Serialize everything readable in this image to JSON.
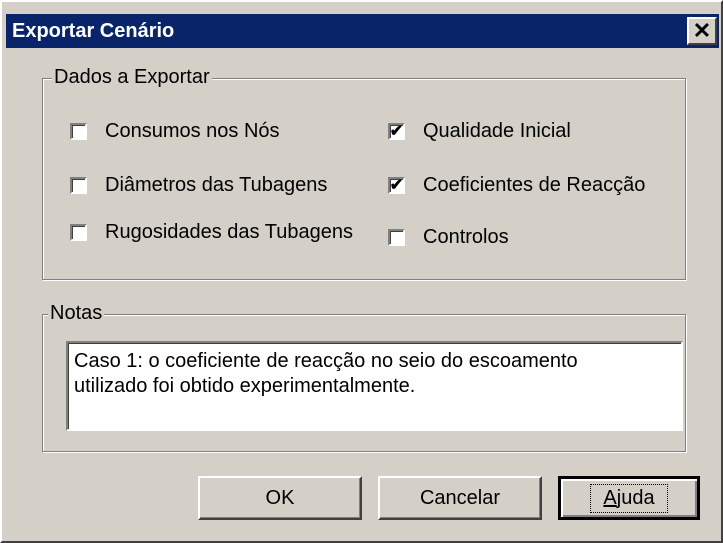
{
  "window": {
    "title": "Exportar Cenário",
    "close_glyph": "✕"
  },
  "data_group": {
    "label": "Dados a Exportar",
    "options": [
      {
        "label": "Consumos nos Nós",
        "checked": false
      },
      {
        "label": "Diâmetros das Tubagens",
        "checked": false
      },
      {
        "label": "Rugosidades das Tubagens",
        "checked": false
      },
      {
        "label": "Qualidade Inicial",
        "checked": true
      },
      {
        "label": "Coeficientes de Reacção",
        "checked": true
      },
      {
        "label": "Controlos",
        "checked": false
      }
    ]
  },
  "notes_group": {
    "label": "Notas",
    "text": "Caso 1: o coeficiente de reacção no seio do escoamento\nutilizado foi obtido experimentalmente."
  },
  "buttons": {
    "ok": "OK",
    "cancel": "Cancelar",
    "help_mnemonic": "A",
    "help_rest": "juda"
  },
  "check_glyph": "✔"
}
